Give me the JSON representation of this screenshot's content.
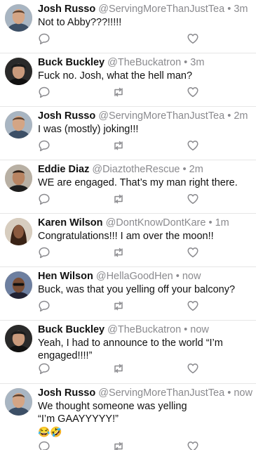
{
  "tweets": [
    {
      "name": "Josh Russo",
      "handle": "@ServingMoreThanJustTea",
      "time": "3m",
      "text": "Not to Abby???!!!!!",
      "avatar": "josh",
      "retweet": false
    },
    {
      "name": "Buck Buckley",
      "handle": "@TheBuckatron",
      "time": "3m",
      "text": "Fuck no. Josh, what the hell man?",
      "avatar": "buck",
      "retweet": true
    },
    {
      "name": "Josh Russo",
      "handle": "@ServingMoreThanJustTea",
      "time": "2m",
      "text": "I was (mostly) joking!!!",
      "avatar": "josh",
      "retweet": true
    },
    {
      "name": "Eddie Diaz",
      "handle": "@DiaztotheRescue",
      "time": "2m",
      "text": "WE are engaged. That’s my man right there.",
      "avatar": "eddie",
      "retweet": true
    },
    {
      "name": "Karen Wilson",
      "handle": "@DontKnowDontKare",
      "time": "1m",
      "text": "Congratulations!!! I am over the moon!!",
      "avatar": "karen",
      "retweet": true
    },
    {
      "name": "Hen Wilson",
      "handle": "@HellaGoodHen",
      "time": "now",
      "text": "Buck, was that you yelling off your balcony?",
      "avatar": "hen",
      "retweet": true
    },
    {
      "name": "Buck Buckley",
      "handle": "@TheBuckatron",
      "time": "now",
      "text": "Yeah, I had to announce to the world “I’m engaged!!!!”",
      "avatar": "buck",
      "retweet": true
    },
    {
      "name": "Josh Russo",
      "handle": "@ServingMoreThanJustTea",
      "time": "now",
      "text": "We thought someone was yelling “I’m GAAYYYYY!”",
      "emoji": "😂🤣",
      "avatar": "josh",
      "retweet": true
    }
  ],
  "separator": "•",
  "colors": {
    "name": "#111111",
    "meta": "#8a8a8e",
    "icon": "#8a8a8e",
    "divider": "#e6e6e6"
  },
  "icons": {
    "reply": "reply-icon",
    "retweet": "retweet-icon",
    "like": "heart-icon"
  }
}
